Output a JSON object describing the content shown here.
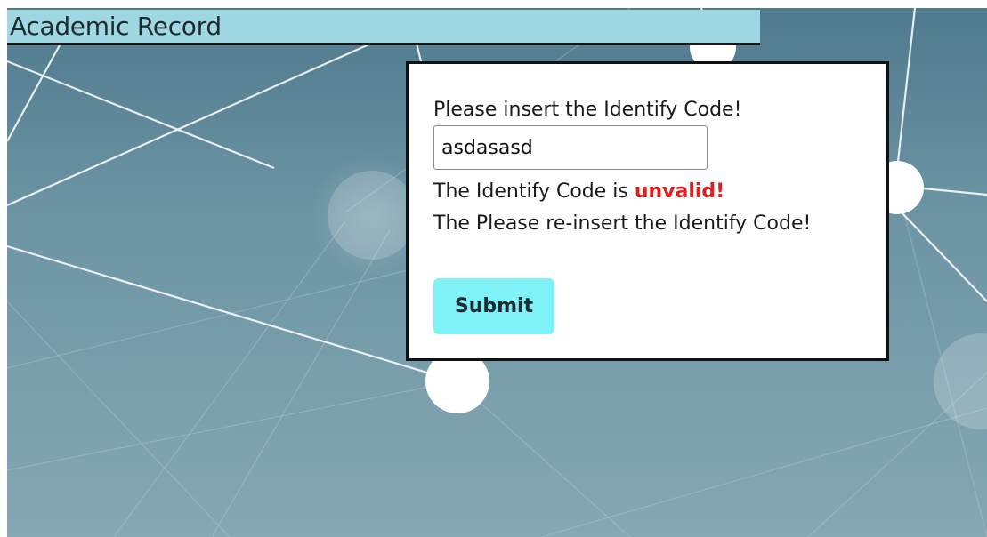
{
  "header": {
    "title": "Academic Record",
    "background_color": "#9fd7e2"
  },
  "dialog": {
    "prompt": "Please insert the Identify Code!",
    "code_input_value": "asdasasd",
    "error_prefix": "The Identify Code is ",
    "error_word": "unvalid!",
    "error_color": "#e0201e",
    "reinsert_text": "The Please re-insert the Identify Code!",
    "submit_label": "Submit",
    "submit_color": "#7ff2f8"
  },
  "background": {
    "image_name": "network-nodes-background"
  }
}
